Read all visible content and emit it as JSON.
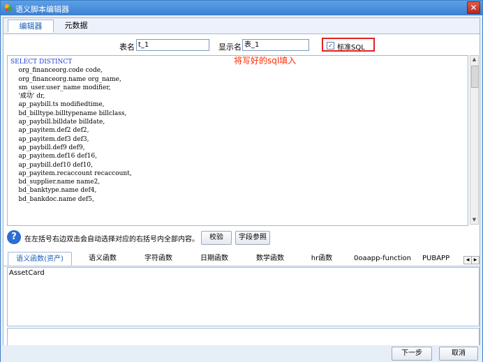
{
  "window": {
    "title": "语义脚本编辑器",
    "close_glyph": "✕"
  },
  "tabs_top": [
    {
      "label": "编辑器",
      "active": true
    },
    {
      "label": "元数据",
      "active": false
    }
  ],
  "form": {
    "table_name_label": "表名",
    "table_name_value": "t_1",
    "display_name_label": "显示名",
    "display_name_value": "表_1",
    "standard_sql_label": "标准SQL",
    "standard_sql_checked": true
  },
  "sql": {
    "lines": [
      "SELECT DISTINCT",
      "    org_financeorg.code code,",
      "    org_financeorg.name org_name,",
      "    sm_user.user_name modifier,",
      "    '成功' dr,",
      "    ap_paybill.ts modifiedtime,",
      "    bd_billtype.billtypename billclass,",
      "    ap_paybill.billdate billdate,",
      "    ap_payitem.def2 def2,",
      "    ap_payitem.def3 def3,",
      "    ap_paybill.def9 def9,",
      "    ap_payitem.def16 def16,",
      "    ap_paybill.def10 def10,",
      "    ap_payitem.recaccount recaccount,",
      "    bd_supplier.name name2,",
      "    bd_banktype.name def4,",
      "    bd_bankdoc.name def5,"
    ],
    "annotation": "将写好的sql填入"
  },
  "info": {
    "help_glyph": "?",
    "text": "在左括号右边双击会自动选择对应的右括号内全部内容。",
    "validate_label": "校验",
    "field_ref_label": "字段参照"
  },
  "tabs_func": [
    {
      "label": "语义函数(资产)",
      "active": true
    },
    {
      "label": "语义函数",
      "active": false
    },
    {
      "label": "字符函数",
      "active": false
    },
    {
      "label": "日期函数",
      "active": false
    },
    {
      "label": "数学函数",
      "active": false
    },
    {
      "label": "hr函数",
      "active": false
    },
    {
      "label": "0oaapp-function",
      "active": false
    },
    {
      "label": "PUBAPP",
      "active": false
    }
  ],
  "func_list": {
    "items": [
      "AssetCard"
    ]
  },
  "footer": {
    "next_label": "下一步",
    "cancel_label": "取消"
  },
  "colors": {
    "titlebar": "#3b80d2",
    "annotation": "#ff2a00",
    "highlight_border": "#e02020",
    "keyword": "#1f3bd6"
  }
}
